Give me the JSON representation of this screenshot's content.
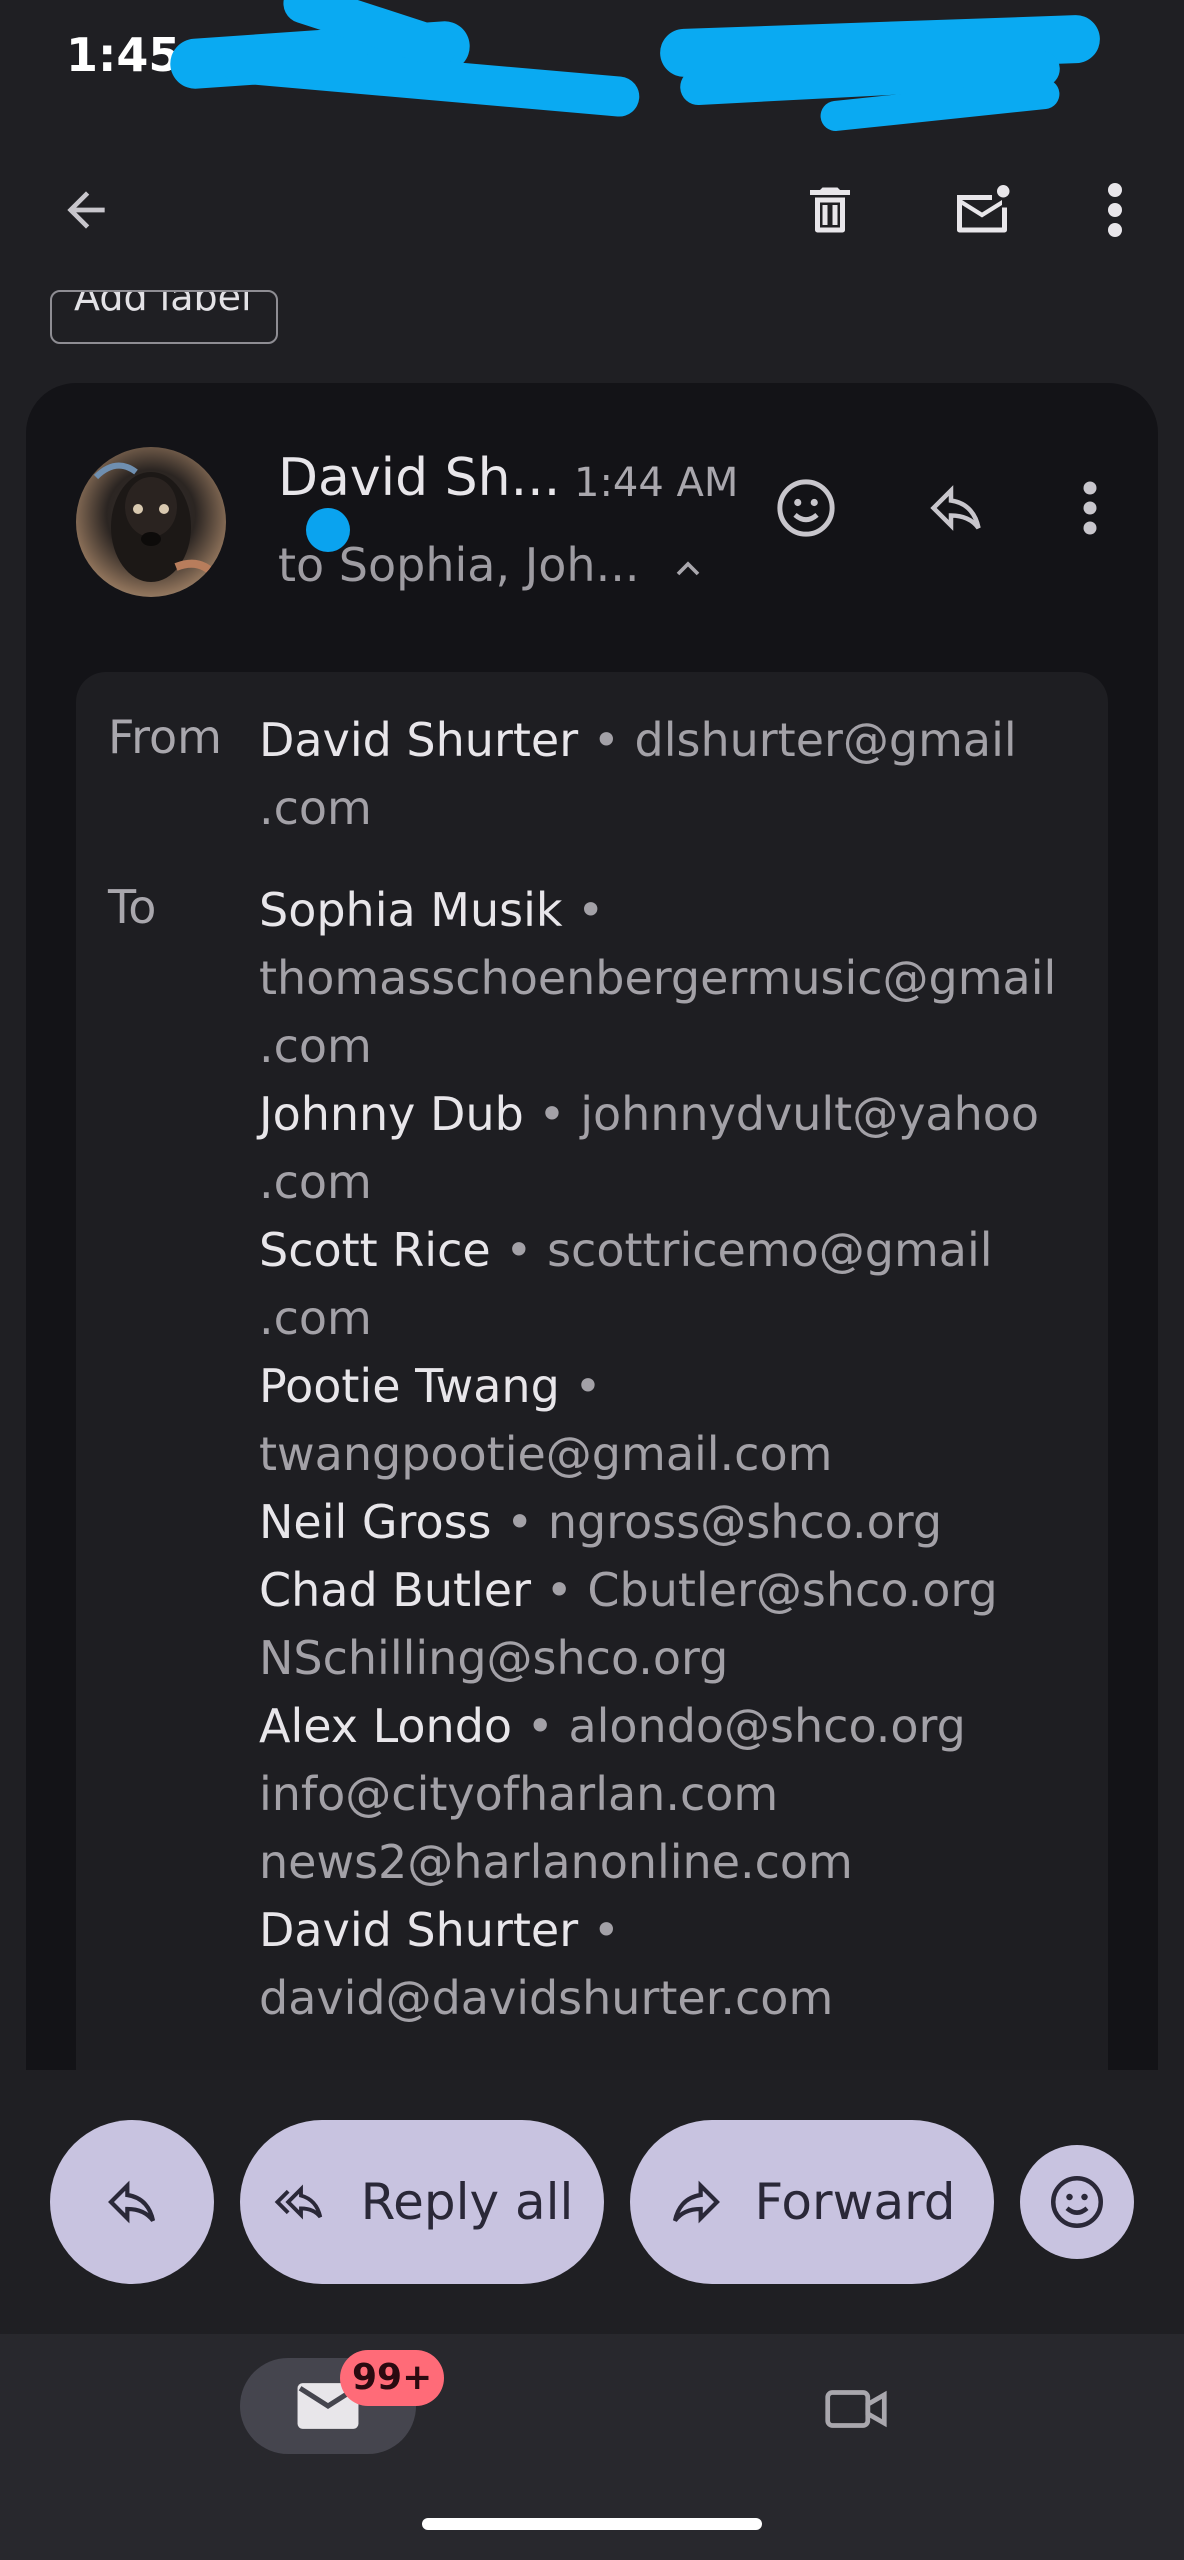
{
  "status_bar": {
    "time": "1:45"
  },
  "app_bar": {
    "back_icon": "arrow-left-icon",
    "delete_icon": "trash-icon",
    "mark_unread_icon": "mail-unread-icon",
    "more_icon": "more-vertical-icon"
  },
  "labels": {
    "add_label": "Add label"
  },
  "message": {
    "sender_short": "David Sh...",
    "time": "1:44 AM",
    "recipients_summary": "to Sophia, Joh...",
    "details": {
      "from_label": "From",
      "to_label": "To",
      "from": {
        "name": "David Shurter",
        "email_line1": "dlshurter@gmail",
        "email_line2": ".com"
      },
      "to": [
        {
          "name": "Sophia Musik",
          "email_line1": "thomasschoenbergermusic@gmail",
          "email_line2": ".com"
        },
        {
          "name": "Johnny Dub",
          "email_line1": "johnnydvult@yahoo",
          "email_line2": ".com"
        },
        {
          "name": "Scott Rice",
          "email_line1": "scottricemo@gmail",
          "email_line2": ".com"
        },
        {
          "name": "Pootie Twang",
          "email_line1": "twangpootie@gmail.com"
        },
        {
          "name": "Neil Gross",
          "email": "ngross@shco.org"
        },
        {
          "name": "Chad Butler",
          "email": "Cbutler@shco.org"
        },
        {
          "email": "NSchilling@shco.org"
        },
        {
          "name": "Alex Londo",
          "email": "alondo@shco.org"
        },
        {
          "email": "info@cityofharlan.com"
        },
        {
          "email": "news2@harlanonline.com"
        },
        {
          "name": "David Shurter",
          "email_line1": "david@davidshurter.com"
        }
      ],
      "separator": "•"
    }
  },
  "actions": {
    "reply_all": "Reply all",
    "forward": "Forward"
  },
  "nav": {
    "mail_badge": "99+"
  },
  "colors": {
    "accent_pill": "#c8c3e0",
    "badge": "#ff6b78",
    "unread_dot": "#0aa3ef"
  }
}
